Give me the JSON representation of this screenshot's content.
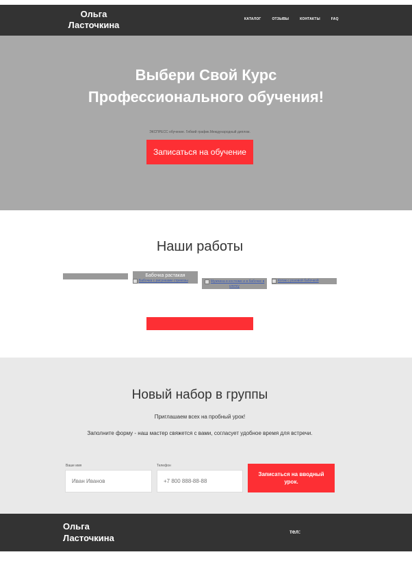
{
  "header": {
    "brand_line1": "Ольга",
    "brand_line2": "Ласточкина",
    "nav": [
      "КАТАЛОГ",
      "ОТЗЫВЫ",
      "КОНТАКТЫ",
      "FAQ"
    ]
  },
  "hero": {
    "title_line1": "Выбери Свой Курс",
    "title_line2": "Профессионального обучения!",
    "subtitle": "ЭКСПРЕСС обучение. Гибкий график.Международный диплом.",
    "button": "Записаться на обучение"
  },
  "works": {
    "title": "Наши работы",
    "items": [
      {
        "caption": "",
        "alt": ""
      },
      {
        "caption": "Бабочка растакая",
        "alt": "Бабочка с рисунками стрекозы"
      },
      {
        "caption": "",
        "alt": "Мужчина в костюме и в бабочке в клетку"
      },
      {
        "caption": "",
        "alt": "Котик с розовой бабочкой"
      }
    ],
    "more_button": ""
  },
  "signup": {
    "title": "Новый набор в группы",
    "text1": "Приглашаем всех на пробный урок!",
    "text2": "Заполните форму - наш мастер свяжется с вами, согласует удобное время для встречи.",
    "name_label": "Ваше имя",
    "name_placeholder": "Иван Иванов",
    "phone_label": "Телефон",
    "phone_placeholder": "+7 800 888-88-88",
    "submit": "Записаться на вводный урок."
  },
  "footer": {
    "brand_line1": "Ольга",
    "brand_line2": "Ласточкина",
    "tel_label": "тел:"
  },
  "colors": {
    "header_bg": "#333333",
    "hero_bg": "#a9a9a9",
    "accent": "#fd2f34",
    "form_bg": "#e9e9e9"
  }
}
